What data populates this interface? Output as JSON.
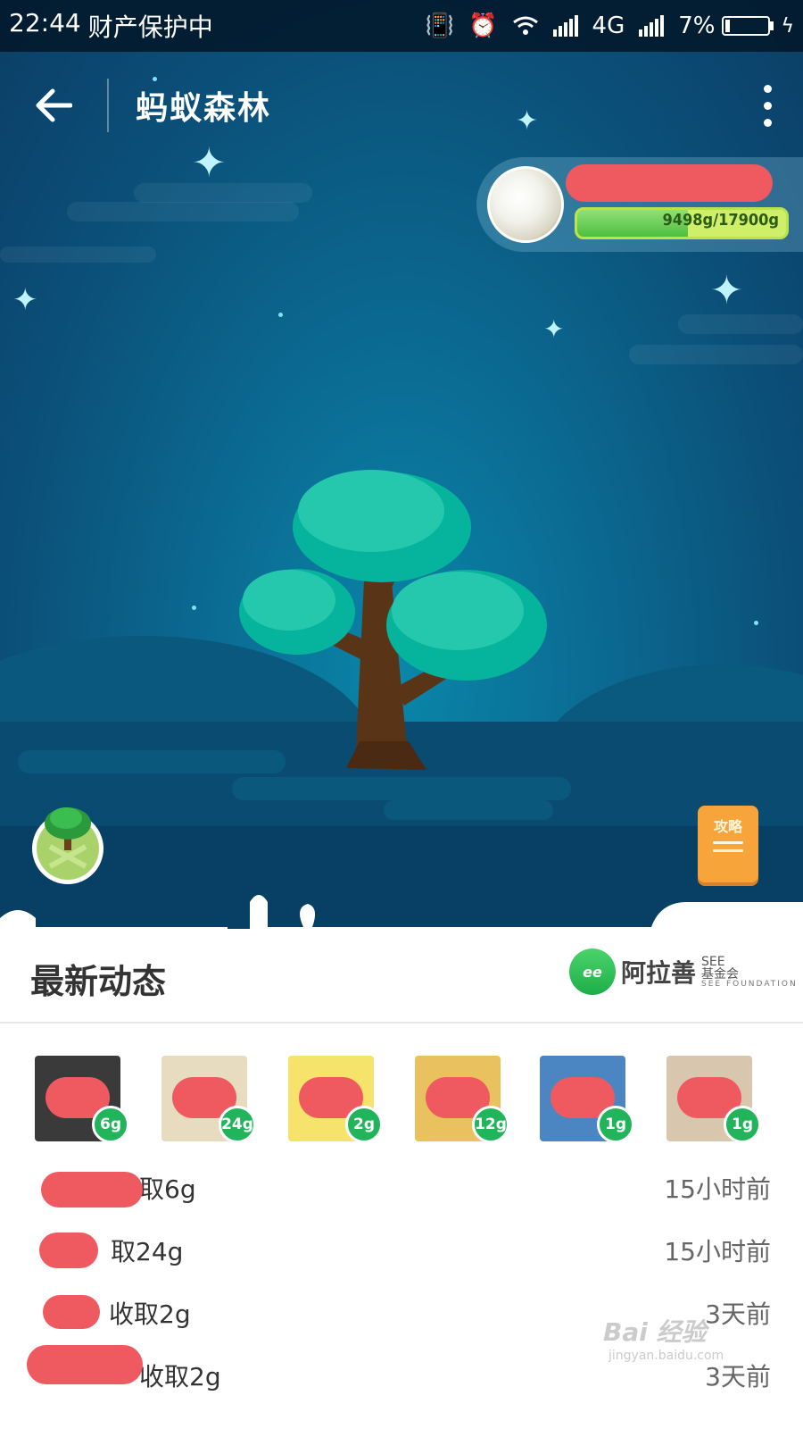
{
  "status_bar": {
    "time": "22:44",
    "status_text": "财产保护中",
    "network": "4G",
    "battery": "7%",
    "icons": [
      "vibrate-off-icon",
      "alarm-icon",
      "wifi-icon",
      "signal-icon",
      "signal-icon",
      "battery-icon",
      "charging-icon"
    ]
  },
  "header": {
    "title": "蚂蚁森林",
    "back_icon": "arrow-left-icon",
    "more_icon": "more-vertical-icon"
  },
  "user": {
    "energy_text": "9498g/17900g",
    "energy_progress": 0.53
  },
  "guide": {
    "label": "攻略"
  },
  "feed": {
    "title": "最新动态",
    "partner_logo_cn": "阿拉善",
    "partner_logo_mark": "SEE",
    "partner_logo_sub": "基金会",
    "partner_logo_en": "SEE FOUNDATION",
    "friends": [
      {
        "amount": "6g",
        "color": "#3a3a3a"
      },
      {
        "amount": "24g",
        "color": "#e8dcc0"
      },
      {
        "amount": "2g",
        "color": "#f5e36b"
      },
      {
        "amount": "12g",
        "color": "#e9c15e"
      },
      {
        "amount": "1g",
        "color": "#4b86c2"
      },
      {
        "amount": "1g",
        "color": "#d9c6ae"
      }
    ],
    "rows": [
      {
        "action": "取6g",
        "time": "15小时前"
      },
      {
        "action": "取24g",
        "time": "15小时前"
      },
      {
        "action": "收取2g",
        "time": "3天前"
      },
      {
        "action": "收取2g",
        "time": "3天前"
      }
    ]
  },
  "watermark": {
    "main": "Bai 经验",
    "sub": "jingyan.baidu.com"
  }
}
